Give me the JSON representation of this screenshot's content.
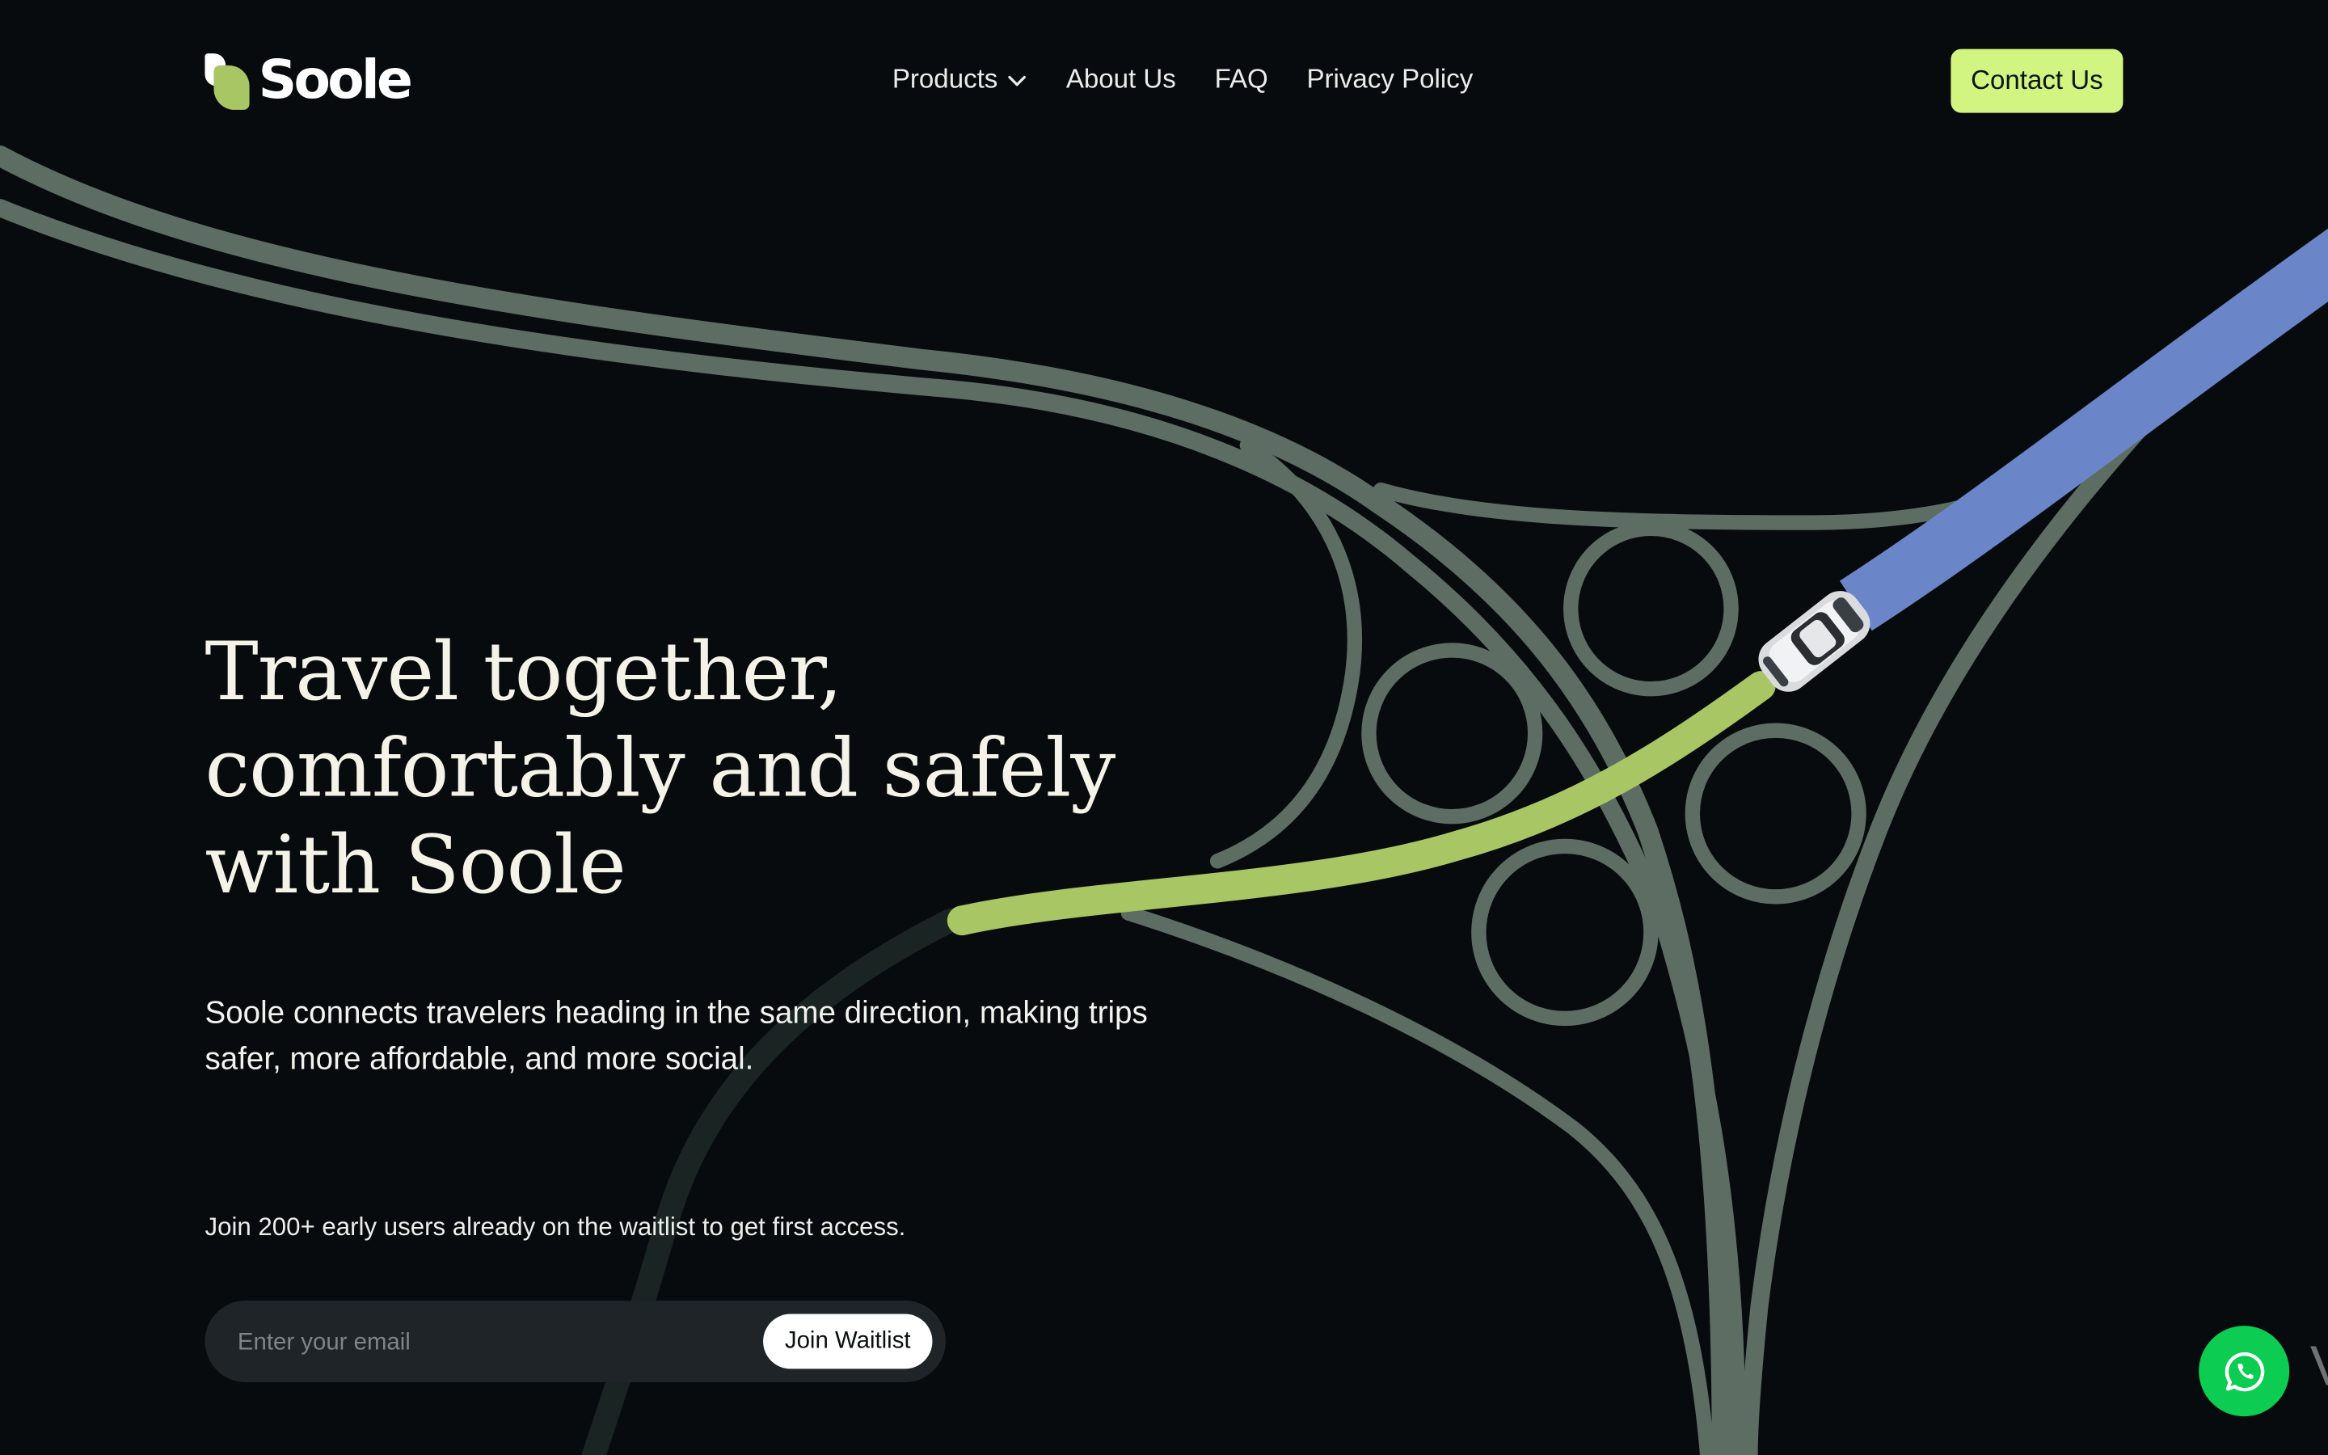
{
  "brand": {
    "name": "Soole",
    "accent": "#d2f581",
    "leaf_color": "#a8c664"
  },
  "nav": {
    "items": [
      {
        "label": "Products",
        "icon": "chevron-down-icon"
      },
      {
        "label": "About Us"
      },
      {
        "label": "FAQ"
      },
      {
        "label": "Privacy Policy"
      }
    ],
    "contact_label": "Contact Us"
  },
  "hero": {
    "title_lines": [
      "Travel together,",
      "comfortably and safely",
      "with Soole"
    ],
    "subtitle_lines": [
      "Soole connects travelers heading in the same direction, making trips",
      "safer, more affordable, and more social."
    ],
    "waitlist_note": "Join 200+ early users already on the waitlist to get first access.",
    "email_placeholder": "Enter your email",
    "join_label": "Join Waitlist"
  },
  "floating": {
    "whatsapp_icon": "whatsapp-icon",
    "whatsapp_color": "#0ccc52",
    "edge_glyph": "V"
  },
  "illustration": {
    "road_color": "#5d6d64",
    "route_done_color": "#6b86c8",
    "route_ahead_color": "#a8c664"
  }
}
